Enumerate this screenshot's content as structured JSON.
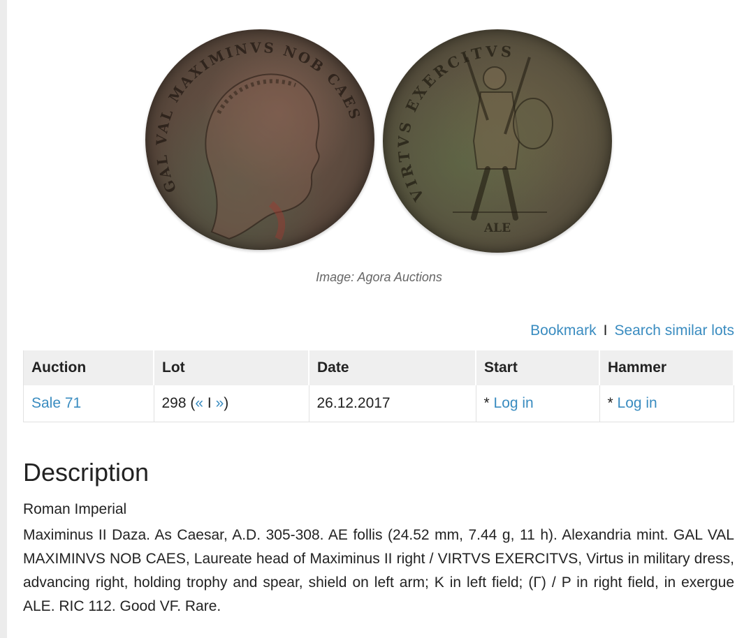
{
  "image": {
    "caption": "Image: Agora Auctions",
    "obverse_legend": "GAL VAL MAXIMINVS NOB CAES",
    "reverse_legend": "VIRTVS EXERCITVS",
    "reverse_exergue": "ALE"
  },
  "actions": {
    "bookmark": "Bookmark",
    "separator": "I",
    "search_similar": "Search similar lots"
  },
  "table": {
    "headers": [
      "Auction",
      "Lot",
      "Date",
      "Start",
      "Hammer"
    ],
    "row": {
      "auction": "Sale 71",
      "lot_number": "298",
      "lot_open": "(",
      "prev": "«",
      "nav_sep": "I",
      "next": "»",
      "lot_close": ")",
      "date": "26.12.2017",
      "start_prefix": "* ",
      "start_link": "Log in",
      "hammer_prefix": "* ",
      "hammer_link": "Log in"
    }
  },
  "description": {
    "heading": "Description",
    "category": "Roman Imperial",
    "text": "Maximinus II Daza. As Caesar, A.D. 305-308. AE follis (24.52 mm, 7.44 g, 11 h). Alexandria mint. GAL VAL MAXIMINVS NOB CAES, Laureate head of Maximinus II right / VIRTVS EXERCITVS, Virtus in military dress, advancing right, holding trophy and spear, shield on left arm; K in left field; (Γ) / P in right field, in exergue ALE. RIC 112. Good VF. Rare."
  },
  "colors": {
    "link": "#3a8cc0",
    "header_bg": "#efefef",
    "caption": "#666666"
  }
}
